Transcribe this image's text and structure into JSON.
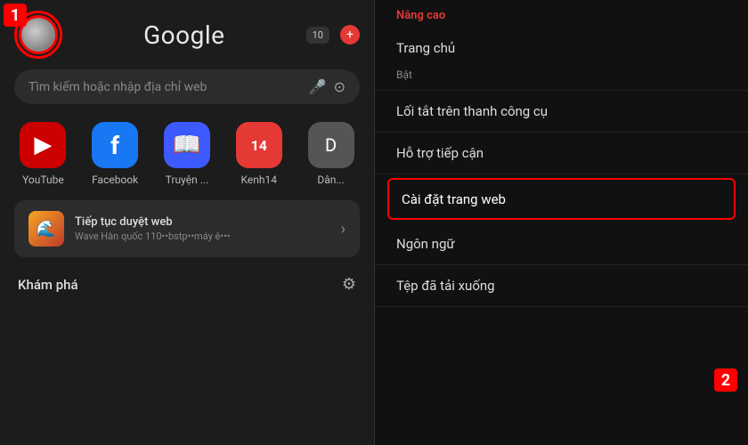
{
  "left": {
    "google_title": "Google",
    "search_placeholder": "Tìm kiếm hoặc nhập địa chỉ web",
    "tab_count": "10",
    "shortcuts": [
      {
        "label": "YouTube",
        "icon_type": "youtube",
        "icon_text": "▶"
      },
      {
        "label": "Facebook",
        "icon_type": "facebook",
        "icon_text": "f"
      },
      {
        "label": "Truyện ...",
        "icon_type": "truyen",
        "icon_text": "📖"
      },
      {
        "label": "Kenh14",
        "icon_type": "kenh14",
        "icon_text": "14"
      },
      {
        "label": "Dân...",
        "icon_type": "dan",
        "icon_text": "D"
      }
    ],
    "continue_card": {
      "title": "Tiếp tục duyệt web",
      "subtitle": "Wave Hàn quốc 110••bstp••máy ê•••"
    },
    "kham_pha": "Khám phá",
    "marker1": "1"
  },
  "right": {
    "section_header": "Nâng cao",
    "items": [
      {
        "label": "Trang chủ",
        "sublabel": "Bật"
      },
      {
        "label": "Lối tắt trên thanh công cụ"
      },
      {
        "label": "Hỗ trợ tiếp cận"
      },
      {
        "label": "Cài đặt trang web",
        "highlighted": true
      },
      {
        "label": "Ngôn ngữ"
      },
      {
        "label": "Tệp đã tải xuống"
      }
    ],
    "marker2": "2"
  }
}
